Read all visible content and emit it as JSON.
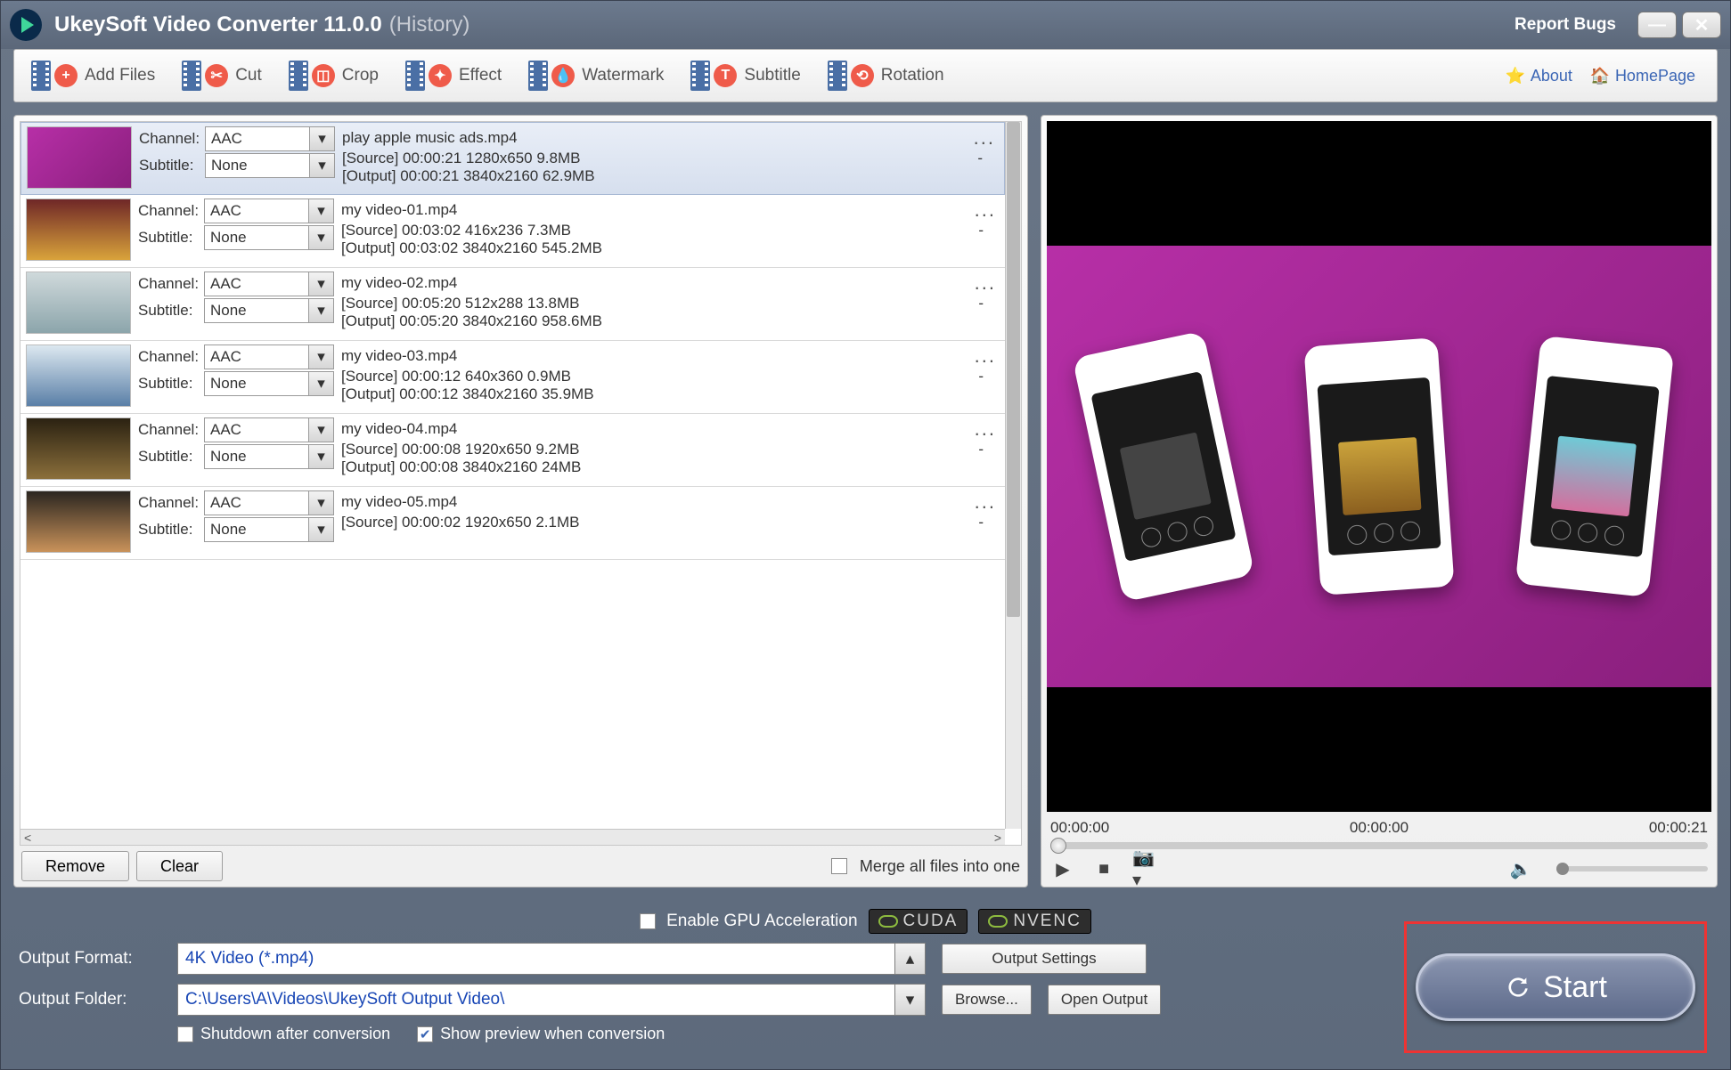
{
  "title": {
    "app": "UkeySoft Video Converter 11.0.0",
    "history": "(History)",
    "report_bugs": "Report Bugs"
  },
  "toolbar": {
    "add_files": "Add Files",
    "cut": "Cut",
    "crop": "Crop",
    "effect": "Effect",
    "watermark": "Watermark",
    "subtitle": "Subtitle",
    "rotation": "Rotation",
    "about": "About",
    "homepage": "HomePage"
  },
  "labels": {
    "channel": "Channel:",
    "subtitle": "Subtitle:",
    "remove": "Remove",
    "clear": "Clear",
    "merge": "Merge all files into one",
    "output_format": "Output Format:",
    "output_settings": "Output Settings",
    "output_folder": "Output Folder:",
    "browse": "Browse...",
    "open_output": "Open Output",
    "gpu": "Enable GPU Acceleration",
    "cuda": "CUDA",
    "nvenc": "NVENC",
    "shutdown": "Shutdown after conversion",
    "show_preview": "Show preview when conversion",
    "start": "Start"
  },
  "defaults": {
    "channel_value": "AAC",
    "subtitle_value": "None",
    "dash": "-"
  },
  "files": [
    {
      "name": "play apple music ads.mp4",
      "source": "[Source]  00:00:21  1280x650  9.8MB",
      "output": "[Output]  00:00:21  3840x2160  62.9MB",
      "thumb": "music",
      "selected": true
    },
    {
      "name": "my video-01.mp4",
      "source": "[Source]  00:03:02  416x236  7.3MB",
      "output": "[Output]  00:03:02  3840x2160  545.2MB",
      "thumb": "cards"
    },
    {
      "name": "my video-02.mp4",
      "source": "[Source]  00:05:20  512x288  13.8MB",
      "output": "[Output]  00:05:20  3840x2160  958.6MB",
      "thumb": "ice"
    },
    {
      "name": "my video-03.mp4",
      "source": "[Source]  00:00:12  640x360  0.9MB",
      "output": "[Output]  00:00:12  3840x2160  35.9MB",
      "thumb": "snow"
    },
    {
      "name": "my video-04.mp4",
      "source": "[Source]  00:00:08  1920x650  9.2MB",
      "output": "[Output]  00:00:08  3840x2160  24MB",
      "thumb": "hall"
    },
    {
      "name": "my video-05.mp4",
      "source": "[Source]  00:00:02  1920x650  2.1MB",
      "output": "",
      "thumb": "sunset"
    }
  ],
  "preview": {
    "t0": "00:00:00",
    "t1": "00:00:00",
    "t2": "00:00:21"
  },
  "output": {
    "format": "4K Video (*.mp4)",
    "folder": "C:\\Users\\A\\Videos\\UkeySoft Output Video\\"
  }
}
